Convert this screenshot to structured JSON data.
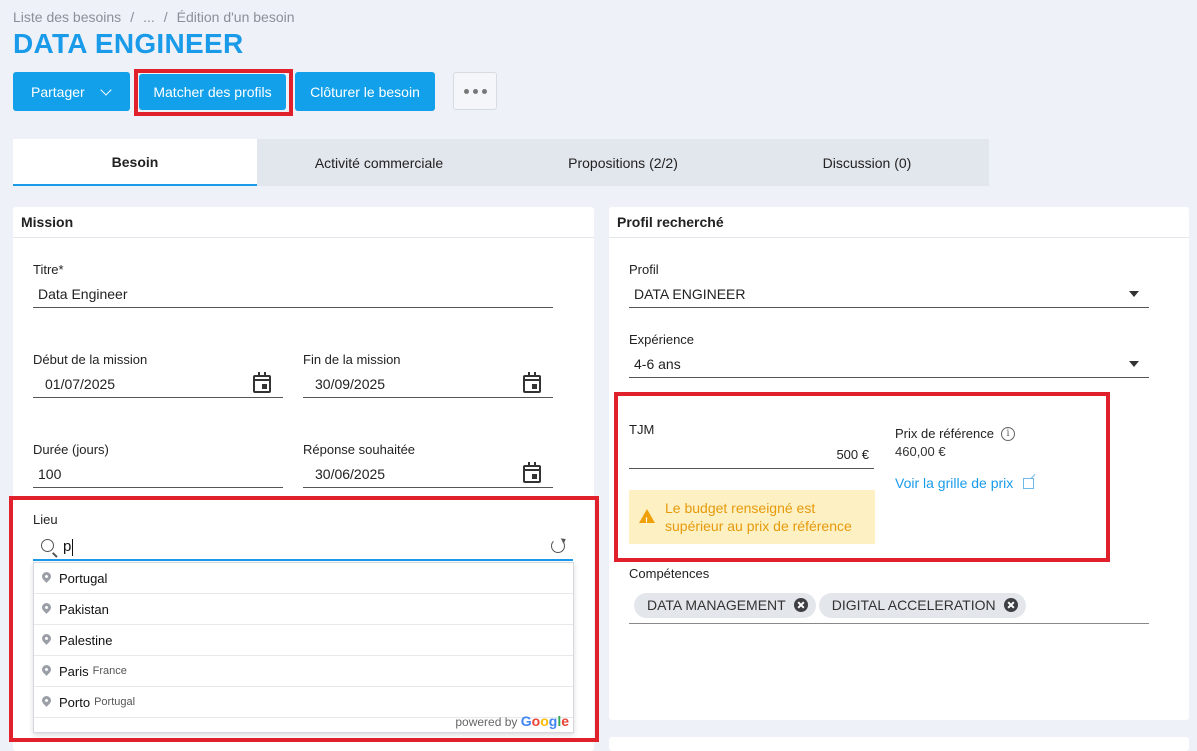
{
  "breadcrumb": {
    "items": [
      "Liste des besoins",
      "/",
      "...",
      "/",
      "Édition d'un besoin"
    ]
  },
  "page": {
    "title": "DATA ENGINEER"
  },
  "toolbar": {
    "share_label": "Partager",
    "match_label": "Matcher des profils",
    "close_label": "Clôturer le besoin"
  },
  "tabs": [
    {
      "label": "Besoin"
    },
    {
      "label": "Activité commerciale"
    },
    {
      "label": "Propositions (2/2)"
    },
    {
      "label": "Discussion (0)"
    }
  ],
  "mission": {
    "title": "Mission",
    "titre_label": "Titre*",
    "titre_value": "Data Engineer",
    "debut_label": "Début de la mission",
    "debut_value": "01/07/2025",
    "fin_label": "Fin de la mission",
    "fin_value": "30/09/2025",
    "duree_label": "Durée (jours)",
    "duree_value": "100",
    "reponse_label": "Réponse souhaitée",
    "reponse_value": "30/06/2025",
    "lieu_label": "Lieu",
    "lieu_value": "p",
    "suggestions": [
      {
        "main": "Portugal",
        "secondary": ""
      },
      {
        "main": "Pakistan",
        "secondary": ""
      },
      {
        "main": "Palestine",
        "secondary": ""
      },
      {
        "main": "Paris",
        "secondary": "France"
      },
      {
        "main": "Porto",
        "secondary": "Portugal"
      }
    ],
    "powered_by": "powered by",
    "google": "Google"
  },
  "profil": {
    "title": "Profil recherché",
    "profil_label": "Profil",
    "profil_value": "DATA ENGINEER",
    "experience_label": "Expérience",
    "experience_value": "4-6 ans",
    "tjm_label": "TJM",
    "tjm_value": "500 €",
    "ref_label": "Prix de référence",
    "ref_value": "460,00 €",
    "price_link": "Voir la grille de prix",
    "warning": "Le budget renseigné est supérieur au prix de référence",
    "competences_label": "Compétences",
    "competences": [
      "DATA MANAGEMENT",
      "DIGITAL ACCELERATION"
    ]
  },
  "colors": {
    "accent": "#12a0ea",
    "highlight": "#e0202a",
    "warning_bg": "#fdf0c2",
    "warning_text": "#e69a0c"
  }
}
